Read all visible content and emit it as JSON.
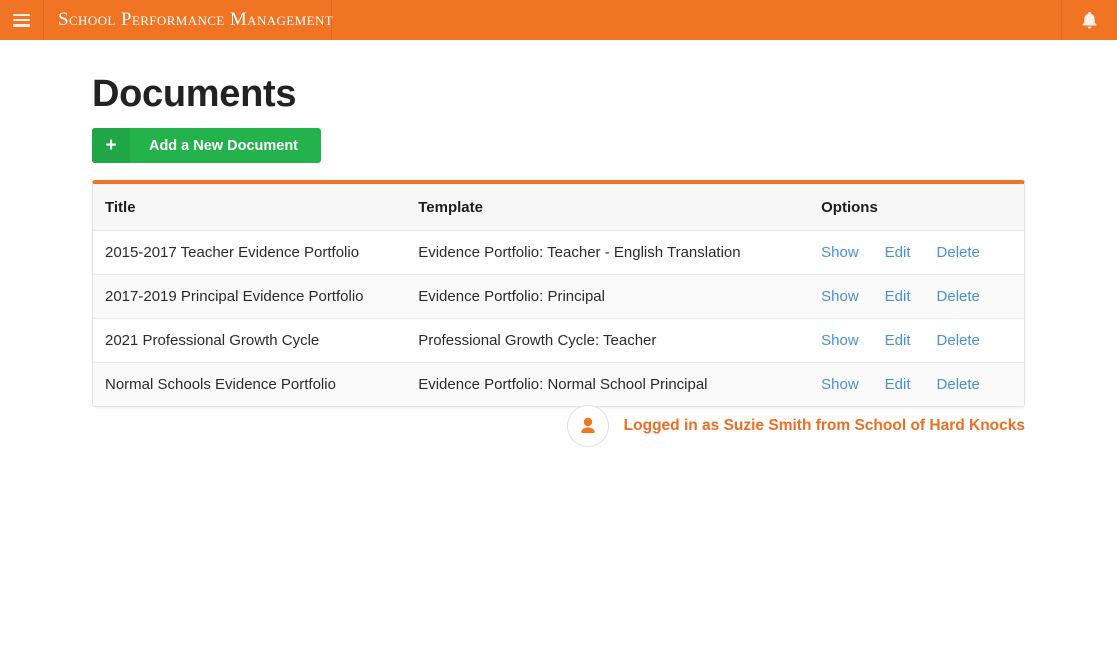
{
  "topbar": {
    "menu_icon": "hamburger-menu-icon",
    "brand": "School Performance Management",
    "bell_icon": "notification-bell-icon",
    "background_color": "#f07423"
  },
  "page": {
    "title": "Documents"
  },
  "add_button": {
    "icon": "plus-icon",
    "icon_glyph": "+",
    "label": "Add a New Document",
    "color": "#23b24c"
  },
  "table": {
    "accent_color": "#f07423",
    "columns": [
      "Title",
      "Template",
      "Options"
    ],
    "rows": [
      {
        "title": "2015-2017 Teacher Evidence Portfolio",
        "template": "Evidence Portfolio: Teacher - English Translation",
        "show": "Show",
        "edit": "Edit",
        "delete": "Delete"
      },
      {
        "title": "2017-2019 Principal Evidence Portfolio",
        "template": "Evidence Portfolio: Principal",
        "show": "Show",
        "edit": "Edit",
        "delete": "Delete"
      },
      {
        "title": "2021 Professional Growth Cycle",
        "template": "Professional Growth Cycle: Teacher",
        "show": "Show",
        "edit": "Edit",
        "delete": "Delete"
      },
      {
        "title": "Normal Schools Evidence Portfolio",
        "template": "Evidence Portfolio: Normal School Principal",
        "show": "Show",
        "edit": "Edit",
        "delete": "Delete"
      }
    ],
    "link_color": "#4a90d9"
  },
  "login_status": {
    "avatar_icon": "user-avatar-icon",
    "text": "Logged in as Suzie Smith from School of Hard Knocks",
    "color": "#ef6f22"
  }
}
